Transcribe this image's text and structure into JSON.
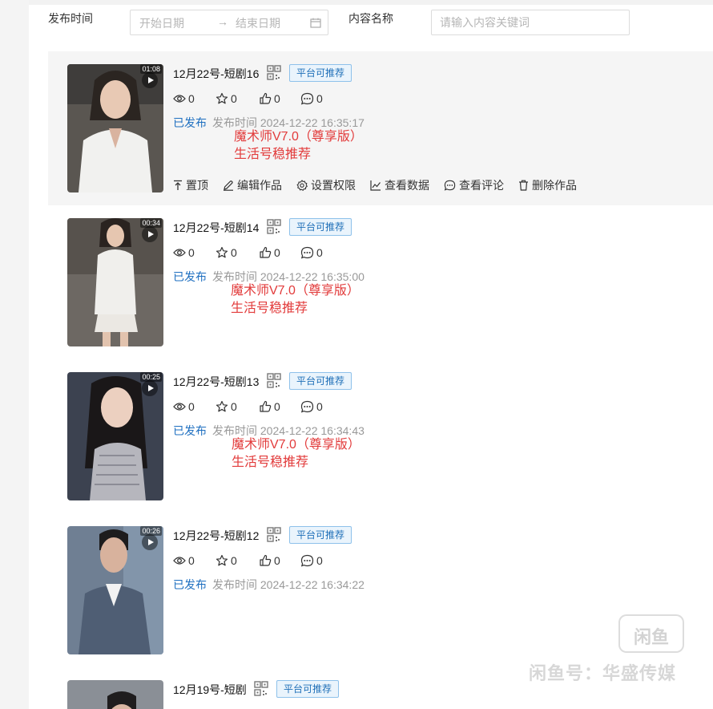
{
  "filters": {
    "publish_time_label": "发布时间",
    "start_placeholder": "开始日期",
    "end_placeholder": "结束日期",
    "range_separator": "→",
    "content_name_label": "内容名称",
    "keyword_placeholder": "请输入内容关键词"
  },
  "actions": {
    "pin": "置顶",
    "edit": "编辑作品",
    "permissions": "设置权限",
    "view_data": "查看数据",
    "view_comments": "查看评论",
    "delete": "删除作品"
  },
  "items": [
    {
      "title": "12月22号-短剧16",
      "duration": "01:08",
      "tag": "平台可推荐",
      "views": "0",
      "favorites": "0",
      "likes": "0",
      "comments": "0",
      "status": "已发布",
      "publish_time": "发布时间 2024-12-22 16:35:17",
      "note_line1": "魔术师V7.0（尊享版）",
      "note_line2": "生活号稳推荐"
    },
    {
      "title": "12月22号-短剧14",
      "duration": "00:34",
      "tag": "平台可推荐",
      "views": "0",
      "favorites": "0",
      "likes": "0",
      "comments": "0",
      "status": "已发布",
      "publish_time": "发布时间 2024-12-22 16:35:00",
      "note_line1": "魔术师V7.0（尊享版）",
      "note_line2": "生活号稳推荐"
    },
    {
      "title": "12月22号-短剧13",
      "duration": "00:25",
      "tag": "平台可推荐",
      "views": "0",
      "favorites": "0",
      "likes": "0",
      "comments": "0",
      "status": "已发布",
      "publish_time": "发布时间 2024-12-22 16:34:43",
      "note_line1": "魔术师V7.0（尊享版）",
      "note_line2": "生活号稳推荐"
    },
    {
      "title": "12月22号-短剧12",
      "duration": "00:26",
      "tag": "平台可推荐",
      "views": "0",
      "favorites": "0",
      "likes": "0",
      "comments": "0",
      "status": "已发布",
      "publish_time": "发布时间 2024-12-22 16:34:22"
    },
    {
      "title": "12月19号-短剧",
      "tag": "平台可推荐"
    }
  ],
  "watermark": {
    "logo_text": "闲鱼",
    "text": "闲鱼号：华盛传媒"
  },
  "colors": {
    "status_blue": "#1e6fc0",
    "tag_blue": "#1f6fb8",
    "note_red": "#e23b3b",
    "highlight_bg": "#f5f5f5"
  },
  "icons": [
    "eye-icon",
    "star-icon",
    "thumb-up-icon",
    "comment-icon",
    "qr-code-icon",
    "pin-icon",
    "edit-icon",
    "gear-icon",
    "chart-line-icon",
    "trash-icon",
    "calendar-icon",
    "play-icon"
  ]
}
